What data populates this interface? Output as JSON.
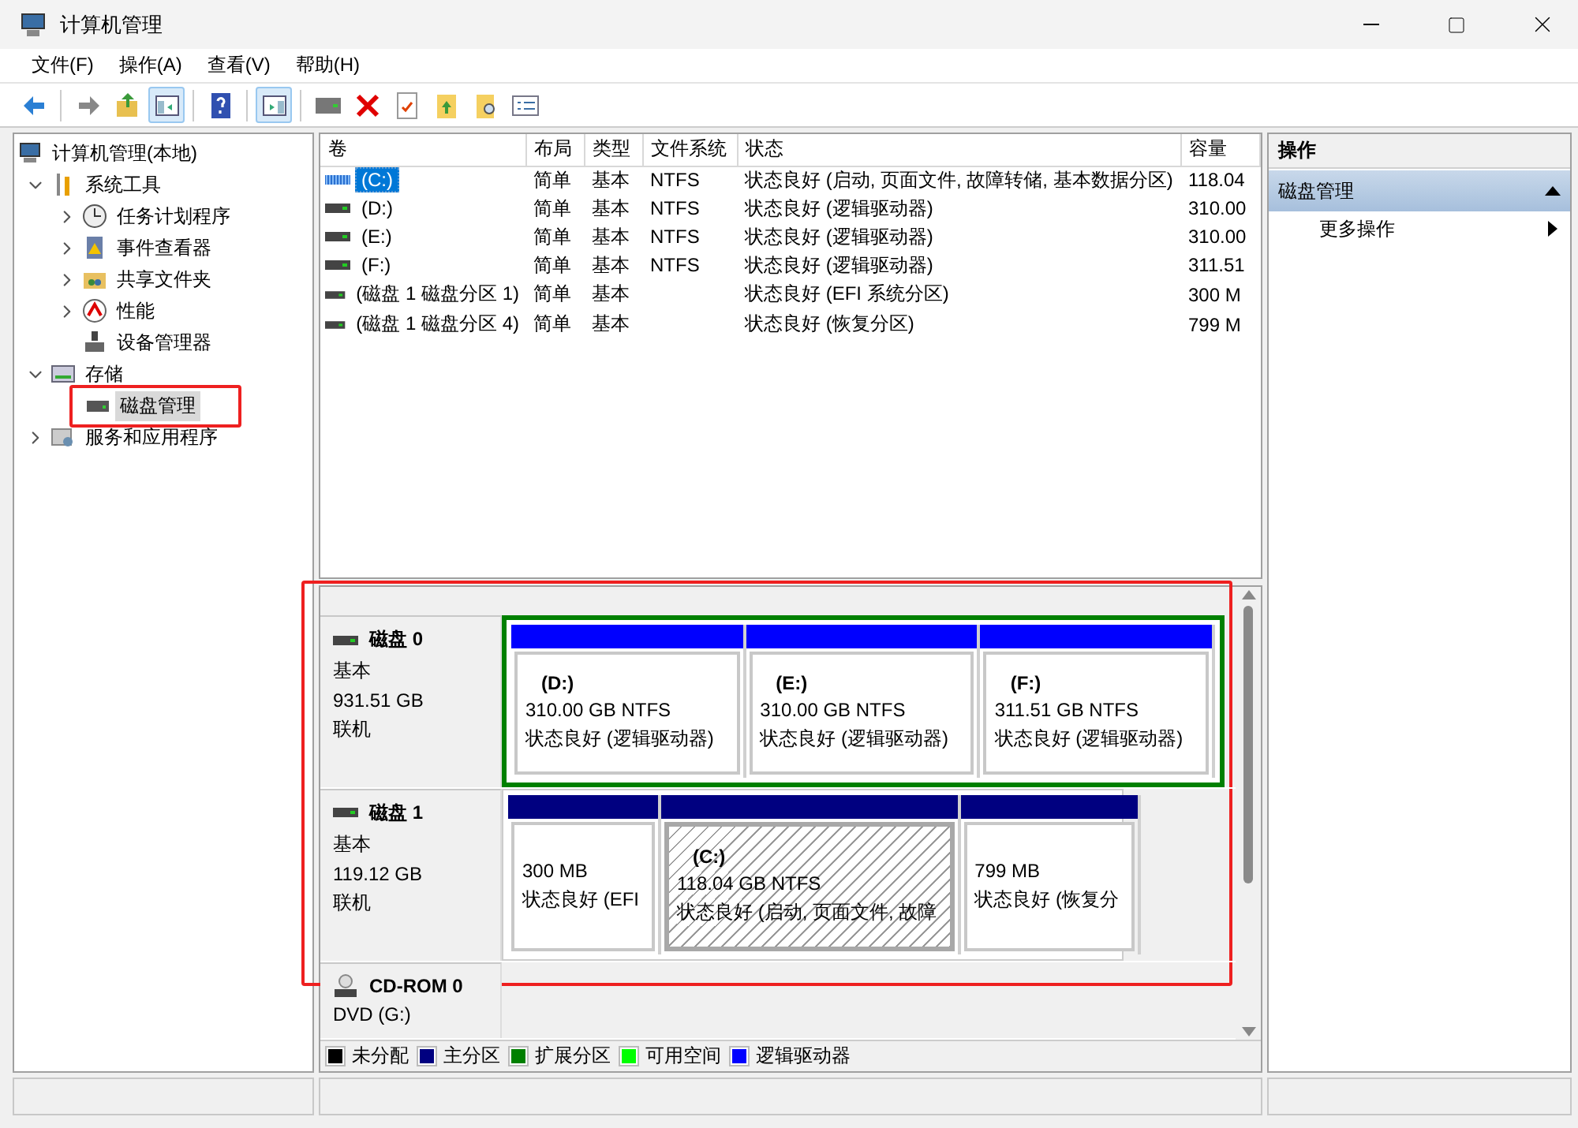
{
  "window": {
    "title": "计算机管理"
  },
  "menu": [
    {
      "label": "文件(F)"
    },
    {
      "label": "操作(A)"
    },
    {
      "label": "查看(V)"
    },
    {
      "label": "帮助(H)"
    }
  ],
  "toolbar": [
    {
      "kind": "back",
      "pressed": false
    },
    {
      "kind": "forward",
      "pressed": false
    },
    {
      "kind": "up",
      "pressed": false
    },
    {
      "kind": "tree",
      "pressed": true
    },
    {
      "kind": "help",
      "pressed": false
    },
    {
      "kind": "pane",
      "pressed": true
    },
    {
      "kind": "connect",
      "pressed": false
    },
    {
      "kind": "delete",
      "pressed": false
    },
    {
      "kind": "properties",
      "pressed": false
    },
    {
      "kind": "export",
      "pressed": false
    },
    {
      "kind": "find",
      "pressed": false
    },
    {
      "kind": "details",
      "pressed": false
    }
  ],
  "tree": [
    {
      "label": "计算机管理(本地)",
      "kind": "computer",
      "selected": false,
      "children": [
        {
          "label": "系统工具",
          "kind": "tools",
          "expanded": true,
          "selected": false,
          "children": [
            {
              "label": "任务计划程序",
              "kind": "clock",
              "expanded": false,
              "selected": false
            },
            {
              "label": "事件查看器",
              "kind": "log",
              "expanded": false,
              "selected": false
            },
            {
              "label": "共享文件夹",
              "kind": "share",
              "expanded": false,
              "selected": false
            },
            {
              "label": "性能",
              "kind": "perf",
              "expanded": false,
              "selected": false
            },
            {
              "label": "设备管理器",
              "kind": "device",
              "selected": false
            }
          ]
        },
        {
          "label": "存储",
          "kind": "storage",
          "expanded": true,
          "selected": false,
          "children": [
            {
              "label": "磁盘管理",
              "kind": "disk",
              "selected": true,
              "highlighted": true
            }
          ]
        },
        {
          "label": "服务和应用程序",
          "kind": "services",
          "expanded": false,
          "selected": false
        }
      ]
    }
  ],
  "table": {
    "columns": [
      "卷",
      "布局",
      "类型",
      "文件系统",
      "状态",
      "容量"
    ],
    "rows": [
      {
        "selected": true,
        "kind": "striped",
        "cells": [
          "(C:)",
          "简单",
          "基本",
          "NTFS",
          "状态良好 (启动, 页面文件, 故障转储, 基本数据分区)",
          "118.04"
        ]
      },
      {
        "selected": false,
        "kind": "drive",
        "cells": [
          "(D:)",
          "简单",
          "基本",
          "NTFS",
          "状态良好 (逻辑驱动器)",
          "310.00"
        ]
      },
      {
        "selected": false,
        "kind": "drive",
        "cells": [
          "(E:)",
          "简单",
          "基本",
          "NTFS",
          "状态良好 (逻辑驱动器)",
          "310.00"
        ]
      },
      {
        "selected": false,
        "kind": "drive",
        "cells": [
          "(F:)",
          "简单",
          "基本",
          "NTFS",
          "状态良好 (逻辑驱动器)",
          "311.51"
        ]
      },
      {
        "selected": false,
        "kind": "drive",
        "cells": [
          "(磁盘 1 磁盘分区 1)",
          "简单",
          "基本",
          "",
          "状态良好 (EFI 系统分区)",
          "300 M"
        ]
      },
      {
        "selected": false,
        "kind": "drive",
        "cells": [
          "(磁盘 1 磁盘分区 4)",
          "简单",
          "基本",
          "",
          "状态良好 (恢复分区)",
          "799 M"
        ]
      }
    ]
  },
  "disk_view": {
    "highlighted": true,
    "disks": [
      {
        "name": "磁盘 0",
        "kind": "disk",
        "type": "基本",
        "size": "931.51 GB",
        "status": "联机",
        "extended": true,
        "partitions": [
          {
            "name": "(D:)",
            "size": "310.00 GB NTFS",
            "status": "状态良好 (逻辑驱动器)",
            "color": "#0000ff",
            "selected": false
          },
          {
            "name": "(E:)",
            "size": "310.00 GB NTFS",
            "status": "状态良好 (逻辑驱动器)",
            "color": "#0000ff",
            "selected": false
          },
          {
            "name": "(F:)",
            "size": "311.51 GB NTFS",
            "status": "状态良好 (逻辑驱动器)",
            "color": "#0000ff",
            "selected": false
          }
        ]
      },
      {
        "name": "磁盘 1",
        "kind": "disk",
        "type": "基本",
        "size": "119.12 GB",
        "status": "联机",
        "extended": false,
        "partitions": [
          {
            "size": "300 MB",
            "status": "状态良好 (EFI",
            "color": "#000080",
            "selected": false
          },
          {
            "name": "(C:)",
            "size": "118.04 GB NTFS",
            "status": "状态良好 (启动, 页面文件, 故障",
            "color": "#000080",
            "selected": true
          },
          {
            "size": "799 MB",
            "status": "状态良好 (恢复分",
            "color": "#000080",
            "selected": false
          }
        ]
      },
      {
        "name": "CD-ROM 0",
        "kind": "cdrom",
        "type": "DVD (G:)"
      }
    ],
    "legend": [
      {
        "label": "未分配",
        "color": "#000000"
      },
      {
        "label": "主分区",
        "color": "#000080"
      },
      {
        "label": "扩展分区",
        "color": "#008000"
      },
      {
        "label": "可用空间",
        "color": "#00ff00"
      },
      {
        "label": "逻辑驱动器",
        "color": "#0000ff"
      }
    ]
  },
  "actions": {
    "title": "操作",
    "sections": [
      {
        "title": "磁盘管理",
        "expanded": true,
        "items": [
          {
            "label": "更多操作"
          }
        ]
      }
    ]
  }
}
